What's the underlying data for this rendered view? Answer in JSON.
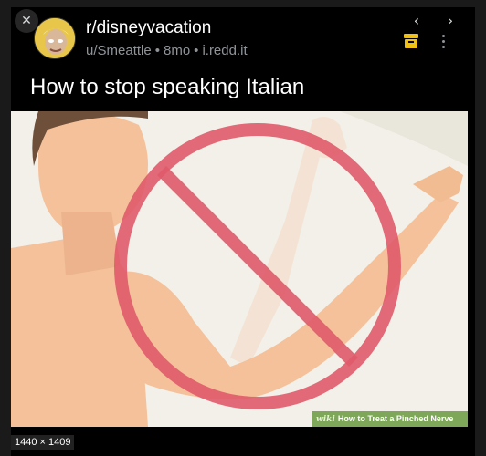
{
  "post": {
    "subreddit": "r/disneyvacation",
    "author": "u/Smeattle",
    "age": "8mo",
    "domain": "i.redd.it",
    "separator": "•",
    "title": "How to stop speaking Italian"
  },
  "controls": {
    "close_glyph": "✕",
    "prev_glyph": "‹",
    "next_glyph": "›"
  },
  "image": {
    "dimensions": "1440 × 1409",
    "watermark_prefix": "wiki",
    "watermark_text": "How to Treat a Pinched Nerve"
  },
  "colors": {
    "background": "#1a1a1b",
    "card": "#000000",
    "save_icon": "#f2c010",
    "prohibition_sign": "#e05a6a",
    "skin": "#f4c19a"
  },
  "icons": [
    "close-icon",
    "chevron-left-icon",
    "chevron-right-icon",
    "save-icon",
    "more-icon",
    "avatar"
  ]
}
